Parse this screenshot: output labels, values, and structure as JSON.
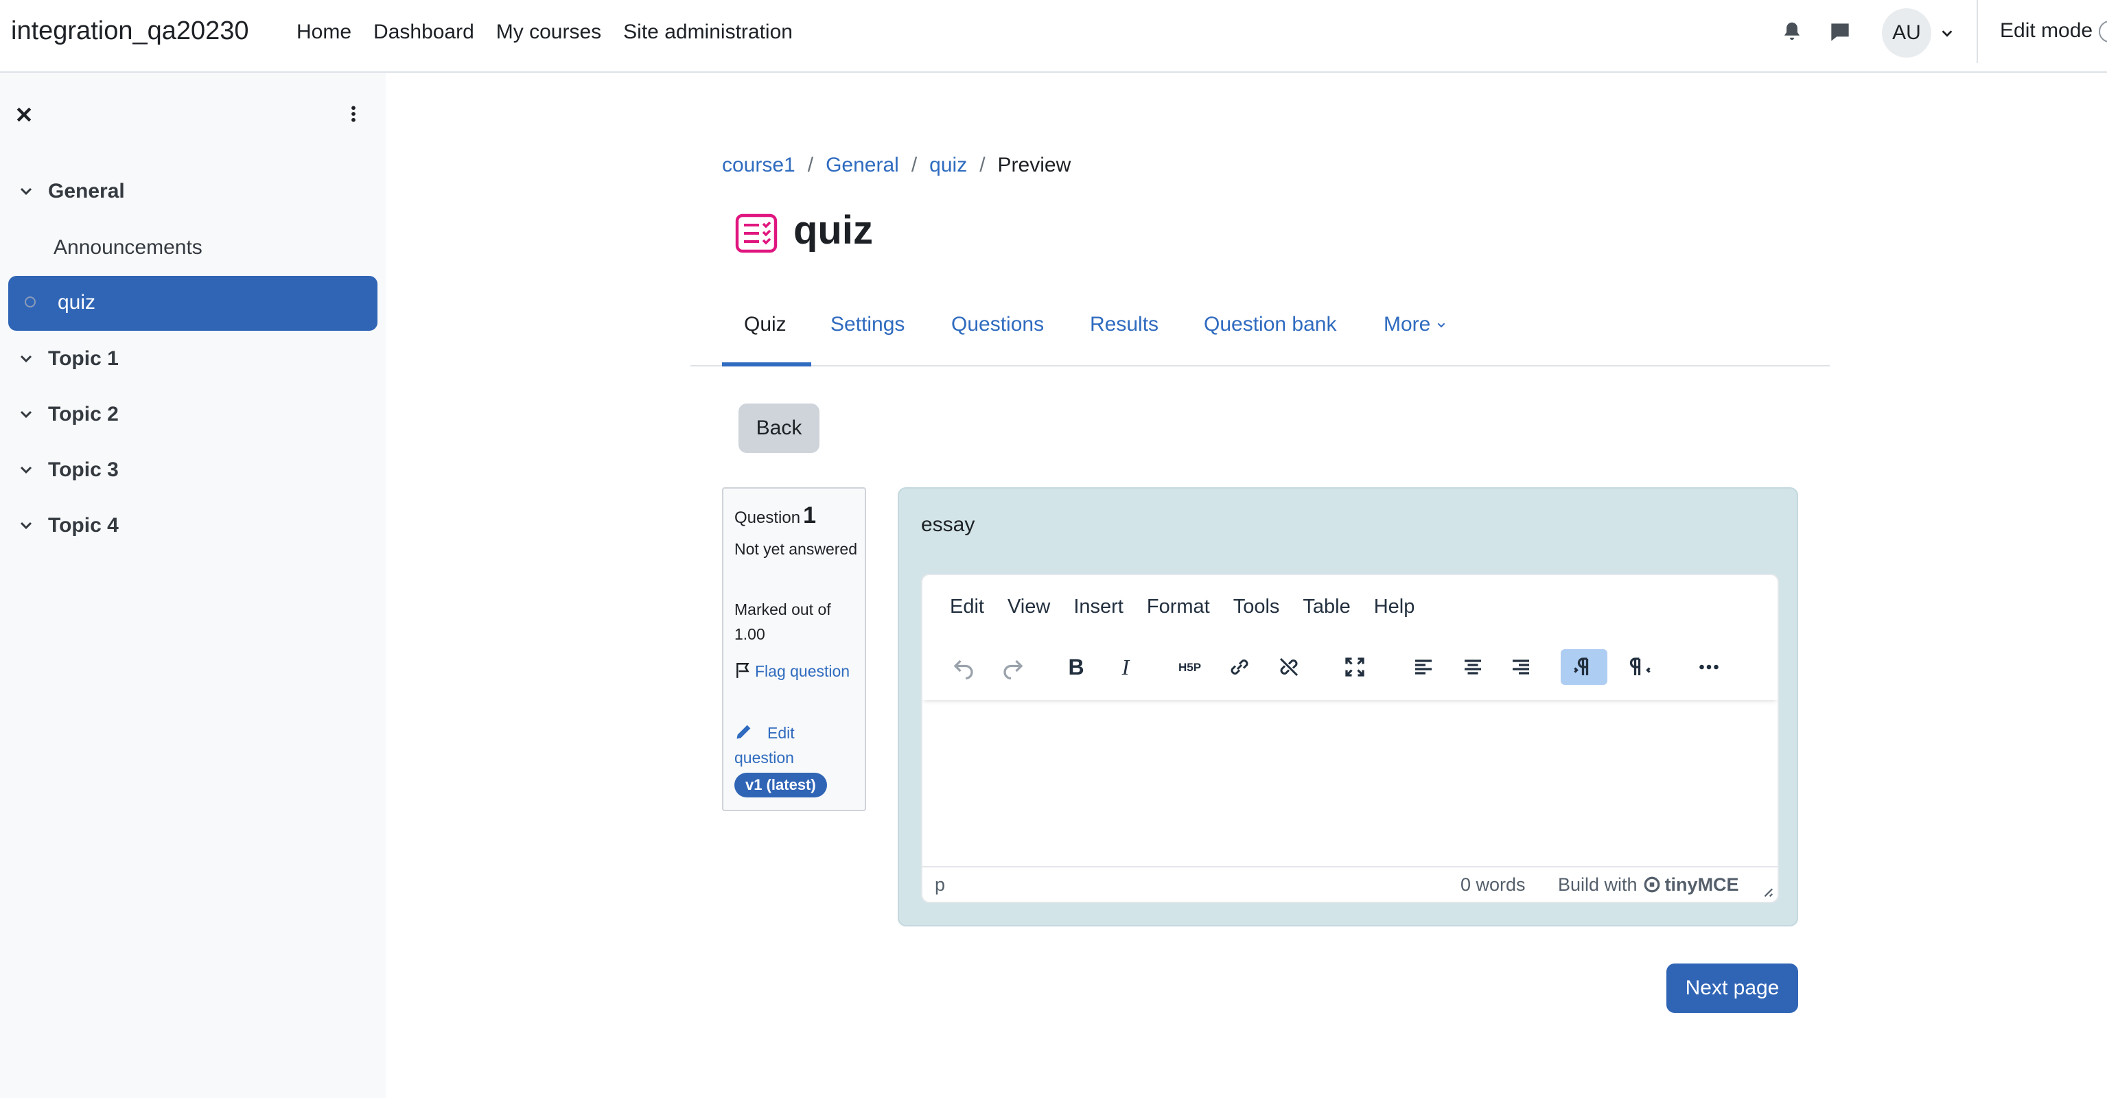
{
  "navbar": {
    "site_name": "integration_qa20230",
    "items": [
      "Home",
      "Dashboard",
      "My courses",
      "Site administration"
    ],
    "avatar_initials": "AU",
    "edit_mode_label": "Edit mode",
    "icons": [
      "bell-icon",
      "chat-icon",
      "chevron-down-icon"
    ]
  },
  "drawer": {
    "sections": [
      {
        "label": "General",
        "items": [
          "Announcements",
          "quiz"
        ]
      },
      {
        "label": "Topic 1"
      },
      {
        "label": "Topic 2"
      },
      {
        "label": "Topic 3"
      },
      {
        "label": "Topic 4"
      }
    ],
    "active_item": "quiz"
  },
  "breadcrumb": [
    "course1",
    "General",
    "quiz",
    "Preview"
  ],
  "page": {
    "title": "quiz",
    "icon": "quiz-icon",
    "icon_color": "#e0167f"
  },
  "tabs": [
    "Quiz",
    "Settings",
    "Questions",
    "Results",
    "Question bank",
    "More"
  ],
  "active_tab": "Quiz",
  "back_label": "Back",
  "question": {
    "label": "Question",
    "number": "1",
    "state": "Not yet answered",
    "grade": "Marked out of 1.00",
    "flag_label": "Flag question",
    "edit_label": "Edit question",
    "version_badge": "v1 (latest)",
    "text": "essay"
  },
  "editor": {
    "menu": [
      "Edit",
      "View",
      "Insert",
      "Format",
      "Tools",
      "Table",
      "Help"
    ],
    "toolbar": [
      "undo",
      "redo",
      "bold",
      "italic",
      "h5p",
      "link",
      "unlink",
      "fullscreen",
      "align-left",
      "align-center",
      "align-right",
      "ltr",
      "rtl",
      "more"
    ],
    "active_toolbar": "ltr",
    "path": "p",
    "word_count": "0 words",
    "branding": "Build with",
    "brand_name": "tinyMCE"
  },
  "next_label": "Next page",
  "colors": {
    "primary": "#3065b6",
    "link": "#2f6bbf",
    "question_bg": "#d3e4e8",
    "drawer_bg": "#f8f9fa"
  }
}
